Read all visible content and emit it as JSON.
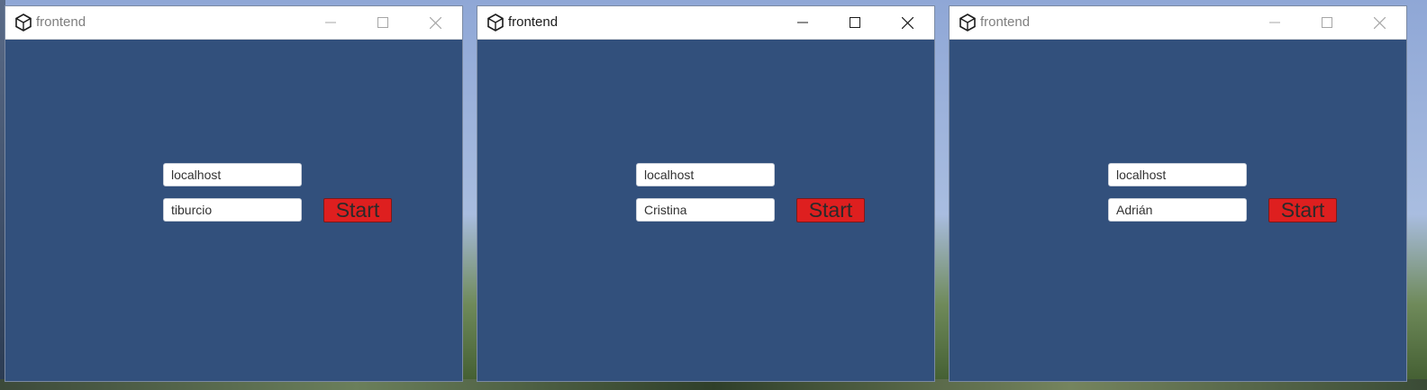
{
  "windows": [
    {
      "title": "frontend",
      "state": "inactive",
      "host_value": "localhost",
      "name_value": "tiburcio",
      "start_label": "Start"
    },
    {
      "title": "frontend",
      "state": "active",
      "host_value": "localhost",
      "name_value": "Cristina",
      "start_label": "Start"
    },
    {
      "title": "frontend",
      "state": "inactive",
      "host_value": "localhost",
      "name_value": "Adrián",
      "start_label": "Start"
    }
  ],
  "colors": {
    "client_background": "#32507c",
    "start_button": "#de1f1f",
    "titlebar": "#ffffff"
  },
  "icons": {
    "app": "unity-logo-icon",
    "minimize": "minimize-icon",
    "maximize": "maximize-icon",
    "close": "close-icon"
  }
}
